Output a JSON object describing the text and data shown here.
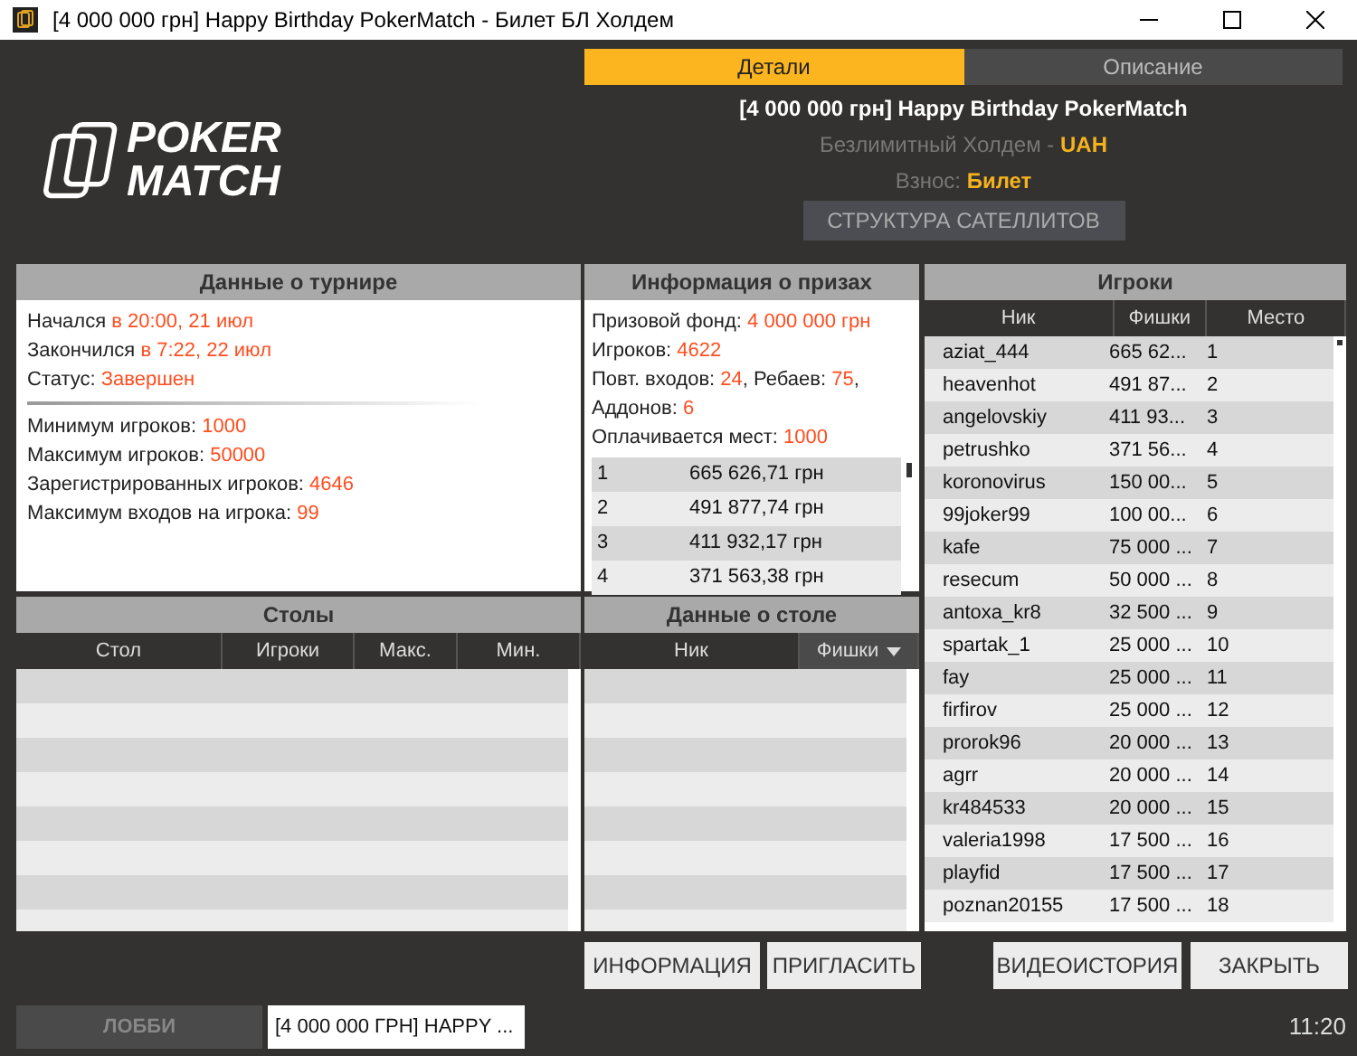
{
  "window": {
    "title": "[4 000 000 грн] Happy Birthday PokerMatch - Билет БЛ Холдем"
  },
  "logo": {
    "line1": "POKER",
    "line2": "MATCH"
  },
  "tabs": [
    {
      "label": "Детали",
      "selected": true
    },
    {
      "label": "Описание",
      "selected": false
    }
  ],
  "tournament_header": {
    "name": "[4 000 000 грн] Happy Birthday PokerMatch",
    "game": [
      {
        "text": "Безлимитный Холдем - ",
        "accent": false
      },
      {
        "text": "UAH",
        "accent": true
      }
    ],
    "fee": [
      {
        "text": "Взнос: ",
        "accent": false
      },
      {
        "text": "Билет",
        "accent": true
      }
    ],
    "satellites_button": "СТРУКТУРА САТЕЛЛИТОВ"
  },
  "tournament_panel": {
    "title": "Данные о турнире",
    "lines_top": [
      [
        {
          "text": "Начался ",
          "accent": false
        },
        {
          "text": "в 20:00, 21 июл",
          "accent": true
        }
      ],
      [
        {
          "text": "Закончился ",
          "accent": false
        },
        {
          "text": "в 7:22, 22 июл",
          "accent": true
        }
      ],
      [
        {
          "text": "Статус: ",
          "accent": false
        },
        {
          "text": "Завершен",
          "accent": true
        }
      ]
    ],
    "lines_bottom": [
      [
        {
          "text": "Минимум игроков: ",
          "accent": false
        },
        {
          "text": "1000",
          "accent": true
        }
      ],
      [
        {
          "text": "Максимум игроков: ",
          "accent": false
        },
        {
          "text": "50000",
          "accent": true
        }
      ],
      [
        {
          "text": "Зарегистрированных игроков: ",
          "accent": false
        },
        {
          "text": "4646",
          "accent": true
        }
      ],
      [
        {
          "text": "Максимум входов на игрока: ",
          "accent": false
        },
        {
          "text": "99",
          "accent": true
        }
      ]
    ]
  },
  "prize_panel": {
    "title": "Информация о призах",
    "lines": [
      [
        {
          "text": "Призовой фонд: ",
          "accent": false
        },
        {
          "text": "4 000 000 грн",
          "accent": true
        }
      ],
      [
        {
          "text": "Игроков: ",
          "accent": false
        },
        {
          "text": "4622",
          "accent": true
        }
      ],
      [
        {
          "text": "Повт. входов: ",
          "accent": false
        },
        {
          "text": "24",
          "accent": true
        },
        {
          "text": ", Ребаев: ",
          "accent": false
        },
        {
          "text": "75",
          "accent": true
        },
        {
          "text": ",",
          "accent": false
        }
      ],
      [
        {
          "text": "Аддонов: ",
          "accent": false
        },
        {
          "text": "6",
          "accent": true
        }
      ],
      [
        {
          "text": "Оплачивается мест: ",
          "accent": false
        },
        {
          "text": "1000",
          "accent": true
        }
      ]
    ],
    "rows": [
      {
        "place": "1",
        "amount": "665 626,71 грн"
      },
      {
        "place": "2",
        "amount": "491 877,74 грн"
      },
      {
        "place": "3",
        "amount": "411 932,17 грн"
      },
      {
        "place": "4",
        "amount": "371 563,38 грн"
      }
    ]
  },
  "players_panel": {
    "title": "Игроки",
    "columns": [
      {
        "label": "Ник",
        "sorted": false
      },
      {
        "label": "Фишки",
        "sorted": false
      },
      {
        "label": "Место",
        "sorted": false
      }
    ],
    "rows": [
      {
        "nick": "aziat_444",
        "chips": "665 62...",
        "place": "1"
      },
      {
        "nick": "heavenhot",
        "chips": "491 87...",
        "place": "2"
      },
      {
        "nick": "angelovskiy",
        "chips": "411 93...",
        "place": "3"
      },
      {
        "nick": "petrushko",
        "chips": "371 56...",
        "place": "4"
      },
      {
        "nick": "koronovirus",
        "chips": "150 00...",
        "place": "5"
      },
      {
        "nick": "99joker99",
        "chips": "100 00...",
        "place": "6"
      },
      {
        "nick": "kafe",
        "chips": "75 000 ...",
        "place": "7"
      },
      {
        "nick": "resecum",
        "chips": "50 000 ...",
        "place": "8"
      },
      {
        "nick": "antoxa_kr8",
        "chips": "32 500 ...",
        "place": "9"
      },
      {
        "nick": "spartak_1",
        "chips": "25 000 ...",
        "place": "10"
      },
      {
        "nick": "fay",
        "chips": "25 000 ...",
        "place": "11"
      },
      {
        "nick": "firfirov",
        "chips": "25 000 ...",
        "place": "12"
      },
      {
        "nick": "prorok96",
        "chips": "20 000 ...",
        "place": "13"
      },
      {
        "nick": "agrr",
        "chips": "20 000 ...",
        "place": "14"
      },
      {
        "nick": "kr484533",
        "chips": "20 000 ...",
        "place": "15"
      },
      {
        "nick": "valeria1998",
        "chips": "17 500 ...",
        "place": "16"
      },
      {
        "nick": "playfid",
        "chips": "17 500 ...",
        "place": "17"
      },
      {
        "nick": "poznan20155",
        "chips": "17 500 ...",
        "place": "18"
      }
    ]
  },
  "tables_panel": {
    "title": "Столы",
    "columns": [
      {
        "label": "Стол",
        "sorted": false
      },
      {
        "label": "Игроки",
        "sorted": false
      },
      {
        "label": "Макс.",
        "sorted": false
      },
      {
        "label": "Мин.",
        "sorted": false
      }
    ]
  },
  "table_data_panel": {
    "title": "Данные о столе",
    "columns": [
      {
        "label": "Ник",
        "sorted": false
      },
      {
        "label": "Фишки",
        "sorted": true
      }
    ]
  },
  "buttons": [
    "ИНФОРМАЦИЯ",
    "ПРИГЛАСИТЬ",
    "ВИДЕОИСТОРИЯ",
    "ЗАКРЫТЬ"
  ],
  "bottom_bar": {
    "tabs": [
      {
        "label": "ЛОББИ",
        "selected": false
      },
      {
        "label": "[4 000 000 ГРН] HAPPY ...",
        "selected": true
      }
    ],
    "time": "11:20"
  }
}
